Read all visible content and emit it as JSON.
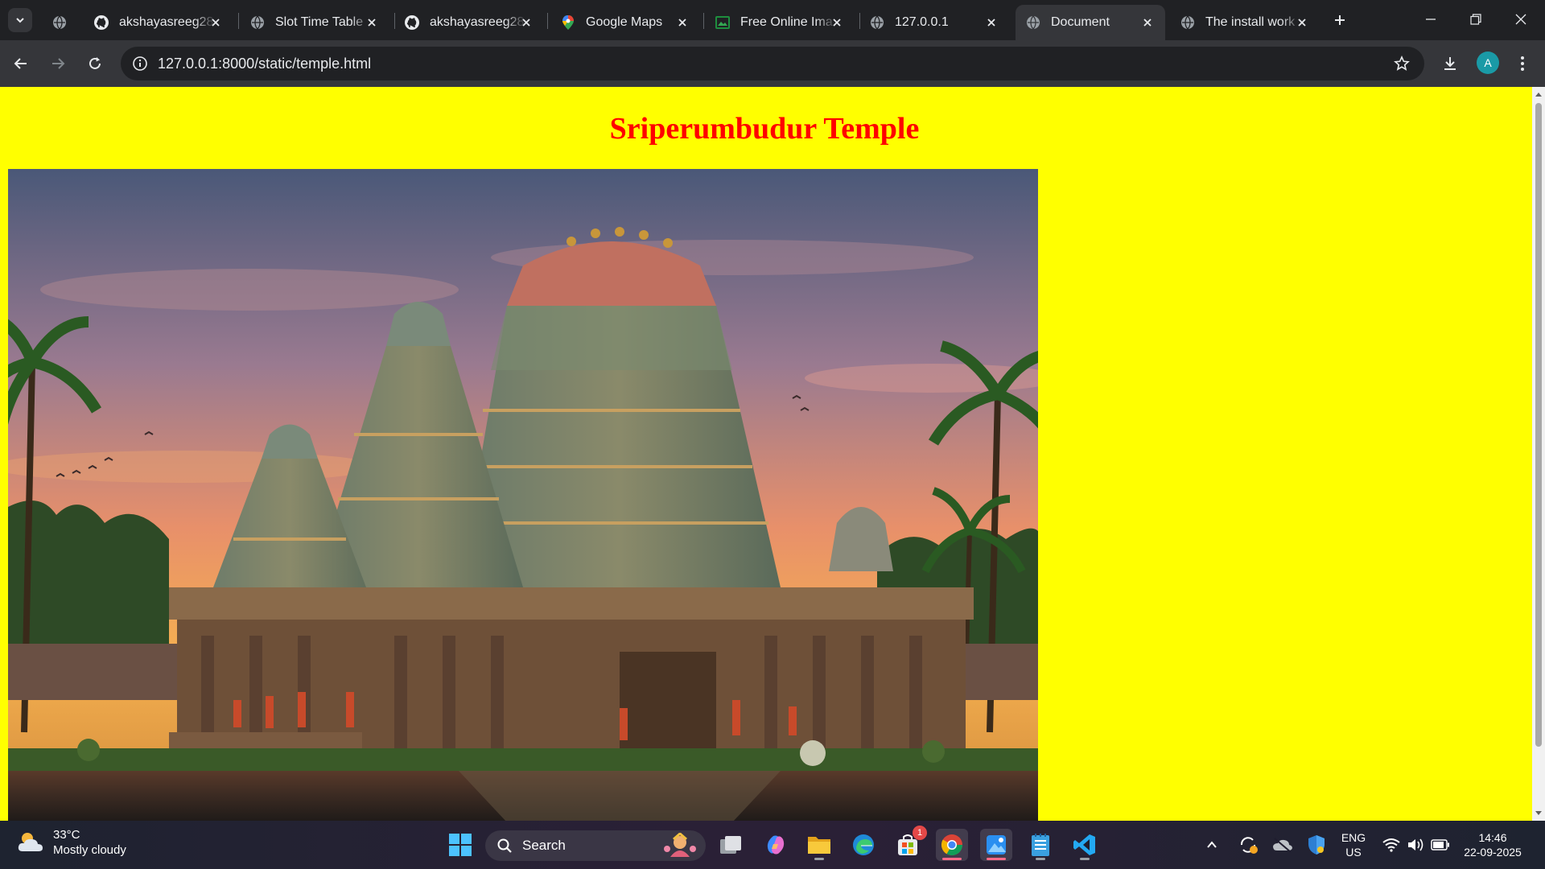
{
  "browser": {
    "tabs": [
      {
        "title": "akshayasreeg28",
        "icon": "github-icon",
        "active": false
      },
      {
        "title": "Slot Time Table",
        "icon": "globe-icon",
        "active": false
      },
      {
        "title": "akshayasreeg28",
        "icon": "github-icon",
        "active": false
      },
      {
        "title": "Google Maps",
        "icon": "google-maps-icon",
        "active": false
      },
      {
        "title": "Free Online Ima",
        "icon": "image-tool-icon",
        "active": false
      },
      {
        "title": "127.0.0.1",
        "icon": "globe-icon",
        "active": false
      },
      {
        "title": "Document",
        "icon": "globe-icon",
        "active": true
      },
      {
        "title": "The install work",
        "icon": "globe-icon",
        "active": false
      }
    ],
    "address_bar": {
      "url": "127.0.0.1:8000/static/temple.html"
    },
    "profile_initial": "A"
  },
  "page": {
    "title": "Sriperumbudur Temple",
    "background_color": "#ffff00",
    "title_color": "#ff0000",
    "image": "temple-photo"
  },
  "taskbar": {
    "weather": {
      "temperature": "33°C",
      "condition": "Mostly cloudy"
    },
    "search_label": "Search",
    "store_badge": "1",
    "language": {
      "lang": "ENG",
      "region": "US"
    },
    "clock": {
      "time": "14:46",
      "date": "22-09-2025"
    }
  }
}
